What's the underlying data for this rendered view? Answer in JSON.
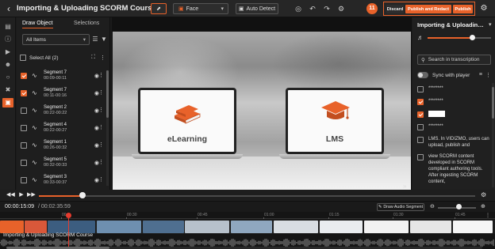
{
  "header": {
    "back_icon": "chevron-left-icon",
    "title": "Importing & Uploading SCORM Course",
    "detect_mode": "Face",
    "auto_detect_label": "Auto Detect",
    "badge_count": "11",
    "discard_label": "Discard",
    "publish_redact_label": "Publish and Redact",
    "publish_label": "Publish",
    "accent_color": "#e8622a"
  },
  "left_panel": {
    "tabs": [
      "Draw Object",
      "Selections"
    ],
    "active_tab": "Draw Object",
    "filter_value": "All Items",
    "select_all_label": "Select All",
    "select_all_count": "(2)",
    "segments": [
      {
        "name": "Segment 7",
        "time": "00:09-00:11",
        "checked": true
      },
      {
        "name": "Segment 7",
        "time": "00:11-00:16",
        "checked": true
      },
      {
        "name": "Segment 2",
        "time": "00:22-00:22",
        "checked": false
      },
      {
        "name": "Segment 4",
        "time": "00:22-00:27",
        "checked": false
      },
      {
        "name": "Segment 1",
        "time": "00:26-00:32",
        "checked": false
      },
      {
        "name": "Segment 5",
        "time": "00:32-00:33",
        "checked": false
      },
      {
        "name": "Segment 3",
        "time": "00:33-00:37",
        "checked": false
      }
    ]
  },
  "video": {
    "left_label": "eLearning",
    "right_label": "LMS"
  },
  "transcript": {
    "title": "Importing & Uploading SCORM Course",
    "volume": 0.7,
    "search_placeholder": "Search in transcription",
    "sync_label": "Sync with player",
    "sync_enabled": false,
    "rows": [
      {
        "text": "********",
        "checked": false,
        "redacted": false
      },
      {
        "text": "********",
        "checked": true,
        "redacted": false
      },
      {
        "text": "********",
        "checked": true,
        "redacted": true
      },
      {
        "text": "********",
        "checked": false,
        "redacted": false
      },
      {
        "text": "LMS. In VIDIZMO, users can upload, publish and",
        "checked": false,
        "redacted": false
      },
      {
        "text": "view SCORM content developed in SCORM compliant authoring tools. After ingesting SCORM content,",
        "checked": false,
        "redacted": false
      }
    ]
  },
  "player": {
    "current_time": "00:00:15:09",
    "duration": "/ 00:02:35:59",
    "progress": 0.1,
    "draw_audio_label": "Draw Audio Segment",
    "zoom_level": 0.55
  },
  "timeline": {
    "ticks": [
      "00",
      "00:30",
      "00:45",
      "01:00",
      "01:15",
      "01:30",
      "01:45",
      "02:00",
      "02:15"
    ],
    "track_title": "Importing & Uploading SCORM Course"
  }
}
